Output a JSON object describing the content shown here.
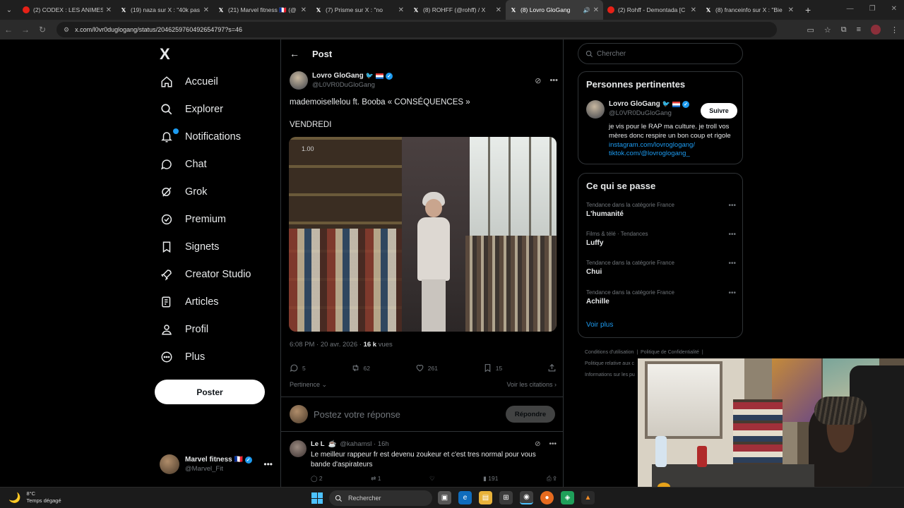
{
  "browser": {
    "tabs": [
      {
        "label": "(2) CODEX : LES ANIMES",
        "favicon": "youtube-icon",
        "active": false
      },
      {
        "label": "(19) naza sur X : \"40k pas",
        "favicon": "x-icon",
        "active": false
      },
      {
        "label": "(21) Marvel fitness 🇫🇷 (@",
        "favicon": "x-icon",
        "active": false
      },
      {
        "label": "(7) Prisme sur X : \"no",
        "favicon": "x-icon",
        "active": false
      },
      {
        "label": "(8) ROHFF (@rohff) / X",
        "favicon": "x-icon",
        "active": false
      },
      {
        "label": "(8) Lovro GloGang",
        "favicon": "x-icon",
        "active": true
      },
      {
        "label": "(2) Rohff - Demontada [C",
        "favicon": "youtube-icon",
        "active": false
      },
      {
        "label": "(8) franceinfo sur X : \"Bie",
        "favicon": "x-icon",
        "active": false
      }
    ],
    "url": "x.com/l0vr0duglogang/status/2046259760492654797?s=46"
  },
  "nav": {
    "logo": "X",
    "items": [
      {
        "label": "Accueil",
        "icon": "home-icon"
      },
      {
        "label": "Explorer",
        "icon": "search-icon"
      },
      {
        "label": "Notifications",
        "icon": "bell-icon"
      },
      {
        "label": "Chat",
        "icon": "chat-icon"
      },
      {
        "label": "Grok",
        "icon": "grok-icon"
      },
      {
        "label": "Premium",
        "icon": "premium-icon"
      },
      {
        "label": "Signets",
        "icon": "bookmark-icon"
      },
      {
        "label": "Creator Studio",
        "icon": "rocket-icon"
      },
      {
        "label": "Articles",
        "icon": "article-icon"
      },
      {
        "label": "Profil",
        "icon": "person-icon"
      },
      {
        "label": "Plus",
        "icon": "more-circle-icon"
      }
    ],
    "post_button": "Poster",
    "account": {
      "name": "Marvel fitness 🇫🇷",
      "handle": "@Marvel_Fit"
    }
  },
  "main": {
    "header": "Post",
    "post": {
      "author_name": "Lovro GloGang",
      "author_handle": "@L0VR0DuGloGang",
      "text_line1": "mademoisellelou ft. Booba « CONSÉQUENCES »",
      "text_line2": "VENDREDI",
      "video_time": "1.00",
      "time": "6:08 PM · 20 avr. 2026 · ",
      "views_count": "16 k",
      "views_label": " vues",
      "replies": "5",
      "reposts": "62",
      "likes": "261",
      "bookmarks": "15",
      "sort_label": "Pertinence",
      "quotes_label": "Voir les citations"
    },
    "reply_box": {
      "placeholder": "Postez votre réponse",
      "button": "Répondre"
    },
    "reply": {
      "name": "Le L",
      "handle": "@kahamsl · 16h",
      "text": "Le meilleur rappeur fr est devenu zoukeur et c'est tres normal pour vous bande d'aspirateurs",
      "replies": "2",
      "reposts": "1",
      "views": "191"
    }
  },
  "sidebar": {
    "search_placeholder": "Chercher",
    "relevant": {
      "title": "Personnes pertinentes",
      "name": "Lovro GloGang",
      "handle": "@L0VR0DuGloGang",
      "follow": "Suivre",
      "bio": "je vis pour le RAP ma culture. je troll vos mères donc respire un bon coup et rigole ",
      "link1": "instagram.com/lovroglogang/",
      "link2": "tiktok.com/@lovroglogang_"
    },
    "trends": {
      "title": "Ce qui se passe",
      "items": [
        {
          "category": "Tendance dans la catégorie France",
          "name": "L'humanité"
        },
        {
          "category": "Films & télé · Tendances",
          "name": "Luffy"
        },
        {
          "category": "Tendance dans la catégorie France",
          "name": "Chui"
        },
        {
          "category": "Tendance dans la catégorie France",
          "name": "Achille"
        }
      ],
      "more": "Voir plus"
    },
    "footer": {
      "terms": "Conditions d'utilisation",
      "privacy": "Politique de Confidentialité",
      "policy": "Politique relative aux c",
      "info": "Informations sur les pu"
    }
  },
  "taskbar": {
    "temp": "8°C",
    "weather": "Temps dégagé",
    "search": "Rechercher"
  },
  "colors": {
    "accent": "#1d9bf0",
    "background": "#000000",
    "border": "#2f3336",
    "muted": "#71767b"
  }
}
